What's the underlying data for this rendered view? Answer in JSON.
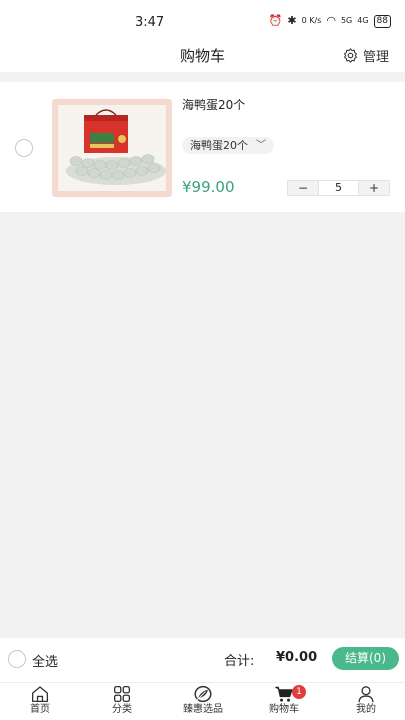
{
  "status_bar": {
    "time": "3:47",
    "network_speed": "0 K/s",
    "network_5g": "5G",
    "network_4g": "4G",
    "battery": "88"
  },
  "nav": {
    "title": "购物车",
    "manage_label": "管理"
  },
  "cart": {
    "items": [
      {
        "name": "海鸭蛋20个",
        "sku": "海鸭蛋20个",
        "price": "¥99.00",
        "quantity": "5",
        "minus": "−",
        "plus": "+"
      }
    ]
  },
  "footer": {
    "select_all": "全选",
    "total_label": "合计:",
    "total_value": "¥0.00",
    "checkout": "结算(0)"
  },
  "tabs": [
    {
      "label": "首页",
      "icon": "home-icon"
    },
    {
      "label": "分类",
      "icon": "grid-icon"
    },
    {
      "label": "臻惠选品",
      "icon": "leaf-icon"
    },
    {
      "label": "购物车",
      "icon": "cart-icon",
      "badge": "1"
    },
    {
      "label": "我的",
      "icon": "user-icon"
    }
  ],
  "colors": {
    "accent": "#3aa37a",
    "checkout": "#49b88a",
    "badge": "#e43b3b"
  }
}
